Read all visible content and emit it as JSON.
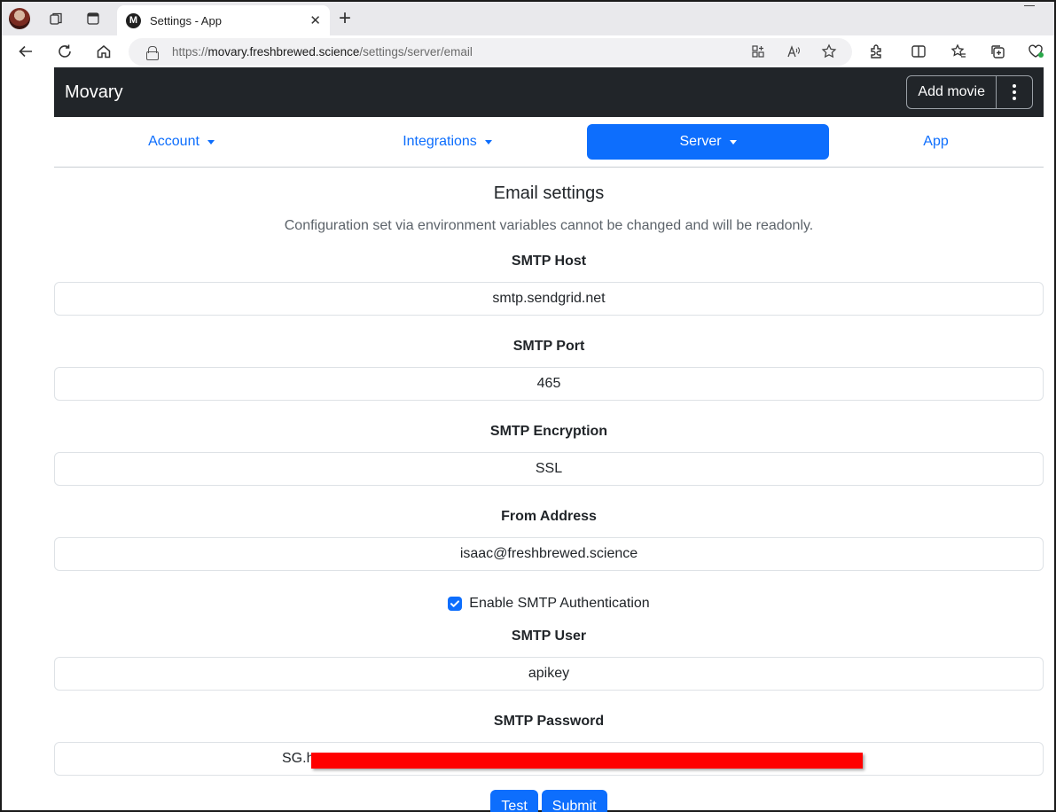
{
  "browser": {
    "tab_title": "Settings - App",
    "url_prefix": "https://",
    "url_host": "movary.freshbrewed.science",
    "url_path": "/settings/server/email",
    "tab_close": "✕",
    "new_tab": "+"
  },
  "app": {
    "brand": "Movary",
    "add_movie_label": "Add movie"
  },
  "tabs": [
    {
      "label": "Account",
      "active": false,
      "dropdown": true
    },
    {
      "label": "Integrations",
      "active": false,
      "dropdown": true
    },
    {
      "label": "Server",
      "active": true,
      "dropdown": true
    },
    {
      "label": "App",
      "active": false,
      "dropdown": false
    }
  ],
  "page": {
    "title": "Email settings",
    "info": "Configuration set via environment variables cannot be changed and will be readonly."
  },
  "form": {
    "smtp_host_label": "SMTP Host",
    "smtp_host_value": "smtp.sendgrid.net",
    "smtp_port_label": "SMTP Port",
    "smtp_port_value": "465",
    "smtp_encryption_label": "SMTP Encryption",
    "smtp_encryption_value": "SSL",
    "from_address_label": "From Address",
    "from_address_value": "isaac@freshbrewed.science",
    "enable_auth_label": "Enable SMTP Authentication",
    "enable_auth_checked": true,
    "smtp_user_label": "SMTP User",
    "smtp_user_value": "apikey",
    "smtp_password_label": "SMTP Password",
    "smtp_password_visible_prefix": "SG.h",
    "test_label": "Test",
    "submit_label": "Submit"
  },
  "colors": {
    "primary": "#0d6efd",
    "navbar": "#212529",
    "redaction": "#ff0000"
  }
}
